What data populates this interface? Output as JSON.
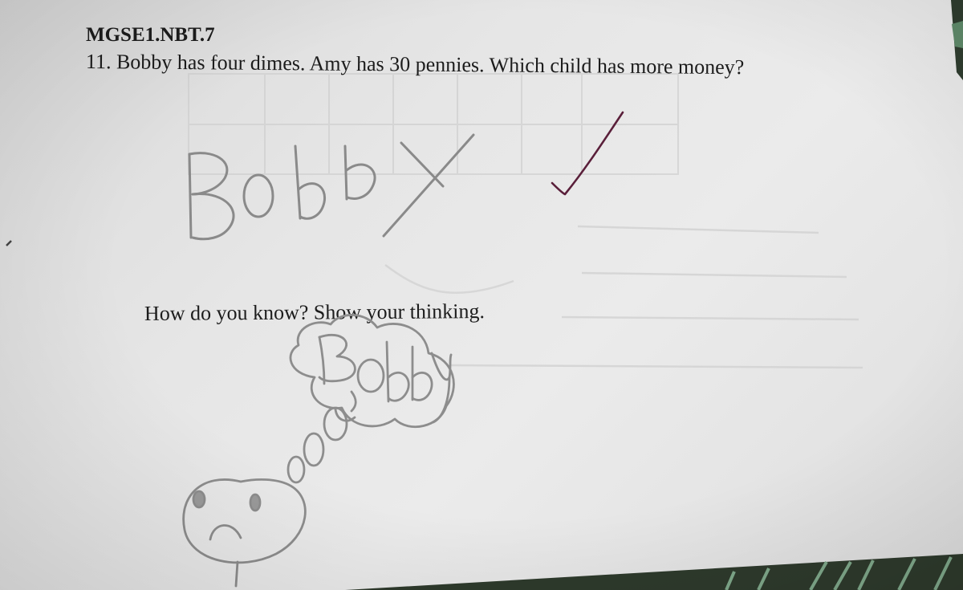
{
  "worksheet": {
    "standard_code": "MGSE1.NBT.7",
    "question": "11. Bobby has four dimes. Amy has 30 pennies. Which child has more money?",
    "followup_prompt": "How do you know? Show your thinking."
  },
  "student_work": {
    "answer": "Bobby",
    "thinking_scribble": "Bobby"
  },
  "teacher_marks": {
    "mark": "checkmark",
    "ink_color": "#5a1f3a"
  },
  "colors": {
    "paper": "#e4e4e4",
    "pencil": "#8a8a8a",
    "printed_text": "#1c1c1c",
    "table": "#2e3a2c"
  }
}
